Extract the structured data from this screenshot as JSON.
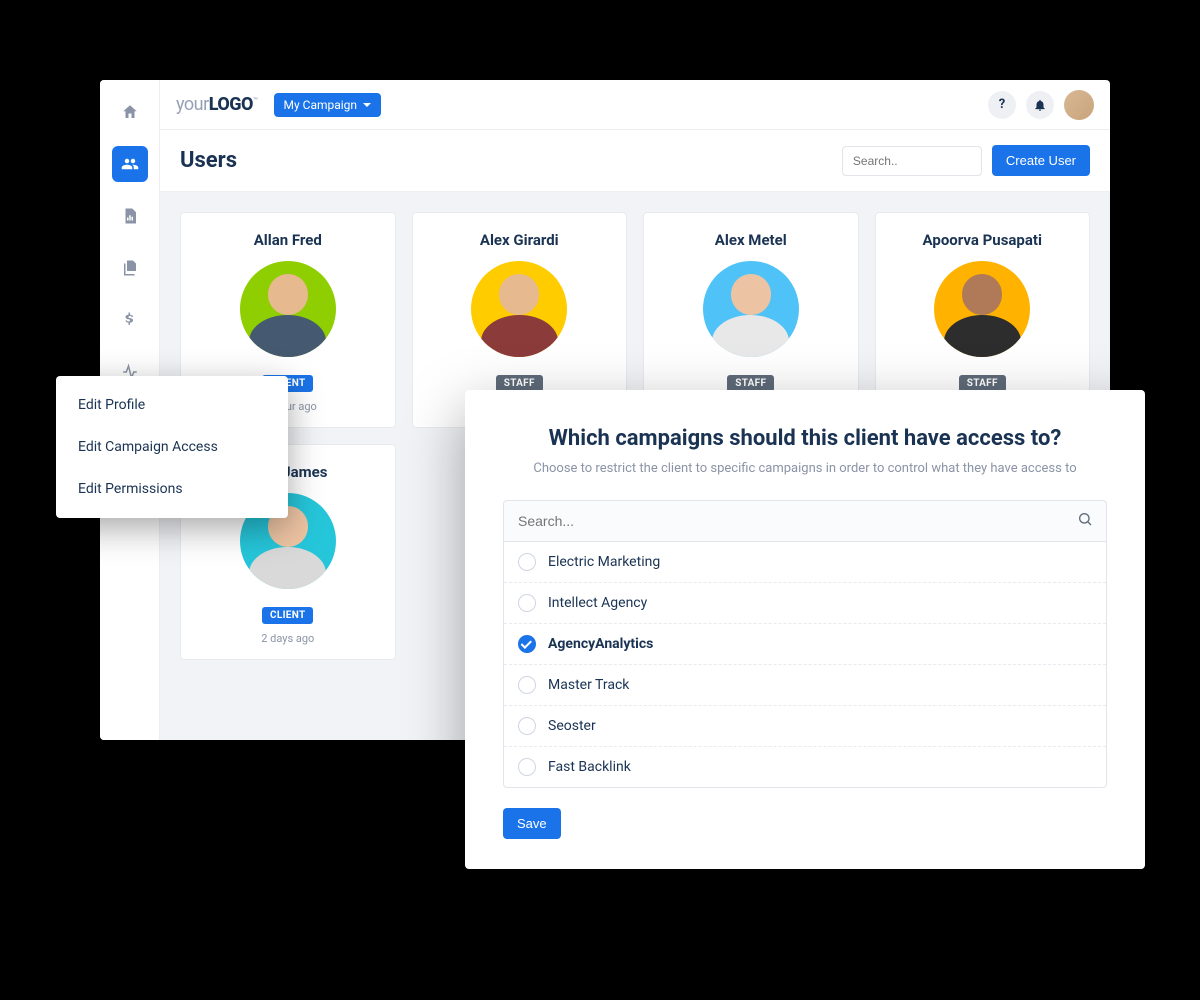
{
  "logo": {
    "prefix": "your",
    "main": "LOGO",
    "tm": "™"
  },
  "campaign_dropdown": {
    "label": "My Campaign"
  },
  "topbar": {
    "help": "?",
    "notifications": "bell"
  },
  "page": {
    "title": "Users",
    "search_placeholder": "Search..",
    "create_button": "Create User"
  },
  "users": [
    {
      "name": "Allan Fred",
      "role": "CLIENT",
      "role_type": "client",
      "meta": "an hour ago",
      "avatar_bg": "#8fce00",
      "skin": "#e6b98f",
      "shirt": "#455a70"
    },
    {
      "name": "Alex Girardi",
      "role": "STAFF",
      "role_type": "staff",
      "meta": "",
      "avatar_bg": "#ffcc00",
      "skin": "#e6b98f",
      "shirt": "#8c3b3b"
    },
    {
      "name": "Alex Metel",
      "role": "STAFF",
      "role_type": "staff",
      "meta": "",
      "avatar_bg": "#4fc3f7",
      "skin": "#edc4a3",
      "shirt": "#e8e8e8"
    },
    {
      "name": "Apoorva Pusapati",
      "role": "STAFF",
      "role_type": "staff",
      "meta": "",
      "avatar_bg": "#ffb300",
      "skin": "#b07a58",
      "shirt": "#2d2d2d"
    },
    {
      "name": "Amy James",
      "role": "CLIENT",
      "role_type": "client",
      "meta": "2 days ago",
      "avatar_bg": "#26c6da",
      "skin": "#edc4a3",
      "shirt": "#d9d9d9"
    }
  ],
  "context_menu": {
    "items": [
      "Edit Profile",
      "Edit Campaign Access",
      "Edit Permissions"
    ]
  },
  "modal": {
    "title": "Which campaigns should this client have access to?",
    "subtitle": "Choose to restrict the client to specific campaigns in order to control what they have access to",
    "search_placeholder": "Search...",
    "save_button": "Save",
    "campaigns": [
      {
        "name": "Electric Marketing",
        "selected": false
      },
      {
        "name": "Intellect Agency",
        "selected": false
      },
      {
        "name": "AgencyAnalytics",
        "selected": true
      },
      {
        "name": "Master Track",
        "selected": false
      },
      {
        "name": "Seoster",
        "selected": false
      },
      {
        "name": "Fast Backlink",
        "selected": false
      }
    ]
  }
}
